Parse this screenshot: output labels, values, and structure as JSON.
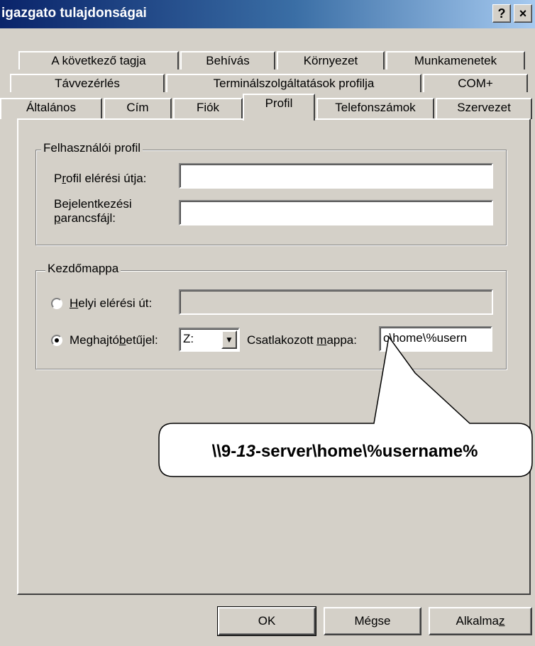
{
  "window": {
    "title": "igazgato tulajdonságai",
    "help_label": "?",
    "close_label": "×"
  },
  "tabs": {
    "row1": [
      "A következő tagja",
      "Behívás",
      "Környezet",
      "Munkamenetek"
    ],
    "row2": [
      "Távvezérlés",
      "Terminálszolgáltatások profilja",
      "COM+"
    ],
    "row3": [
      "Általános",
      "Cím",
      "Fiók",
      "Profil",
      "Telefonszámok",
      "Szervezet"
    ],
    "active": "Profil"
  },
  "profile_group": {
    "title": "Felhasználói profil",
    "profile_path_label_pre": "P",
    "profile_path_label_mnemonic": "r",
    "profile_path_label_post": "ofil elérési útja:",
    "profile_path_value": "",
    "logon_script_label_line1": "Bejelentkezési",
    "logon_script_label_mnemonic": "p",
    "logon_script_label_line2": "arancsfájl:",
    "logon_script_value": ""
  },
  "home_group": {
    "title": "Kezdőmappa",
    "local_path_mnemonic": "H",
    "local_path_label": "elyi elérési út:",
    "local_path_value": "",
    "local_path_selected": false,
    "drive_label_pre": "Meghajtó",
    "drive_label_mnemonic": "b",
    "drive_label_post": "etűjel:",
    "drive_selected": true,
    "drive_value": "Z:",
    "connected_label_pre": "Csatlakozott ",
    "connected_label_mnemonic": "m",
    "connected_label_post": "appa:",
    "connected_value": "c\\home\\%usern"
  },
  "callout": {
    "prefix": "\\\\9-",
    "italic": "13",
    "suffix": "-server\\home\\%username%"
  },
  "buttons": {
    "ok": "OK",
    "cancel": "Mégse",
    "apply_pre": "Alkalma",
    "apply_mnemonic": "z"
  }
}
